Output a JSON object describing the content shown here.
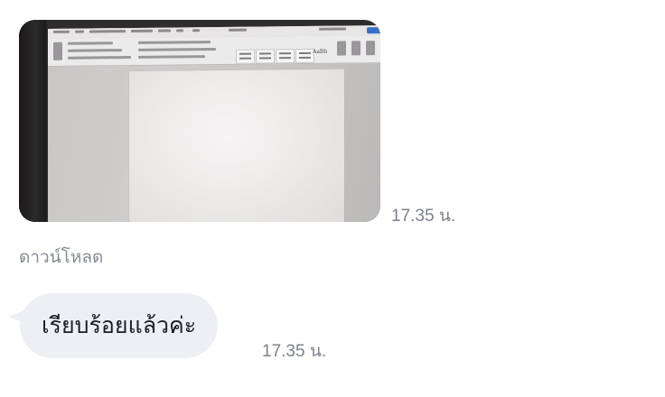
{
  "messages": [
    {
      "type": "image",
      "image_alt": "Photo of a laptop screen showing a word processor with a blank page",
      "time": "17.35 น.",
      "action_label": "ดาวน์โหลด"
    },
    {
      "type": "text",
      "text": "เรียบร้อยแล้วค่ะ",
      "time": "17.35 น."
    }
  ],
  "photo": {
    "visible_text": "AaBb",
    "accent_color": "#3b6ec7"
  },
  "colors": {
    "bubble_bg": "#eeeff3",
    "timestamp": "#7d838c",
    "text": "#1c1d22"
  }
}
